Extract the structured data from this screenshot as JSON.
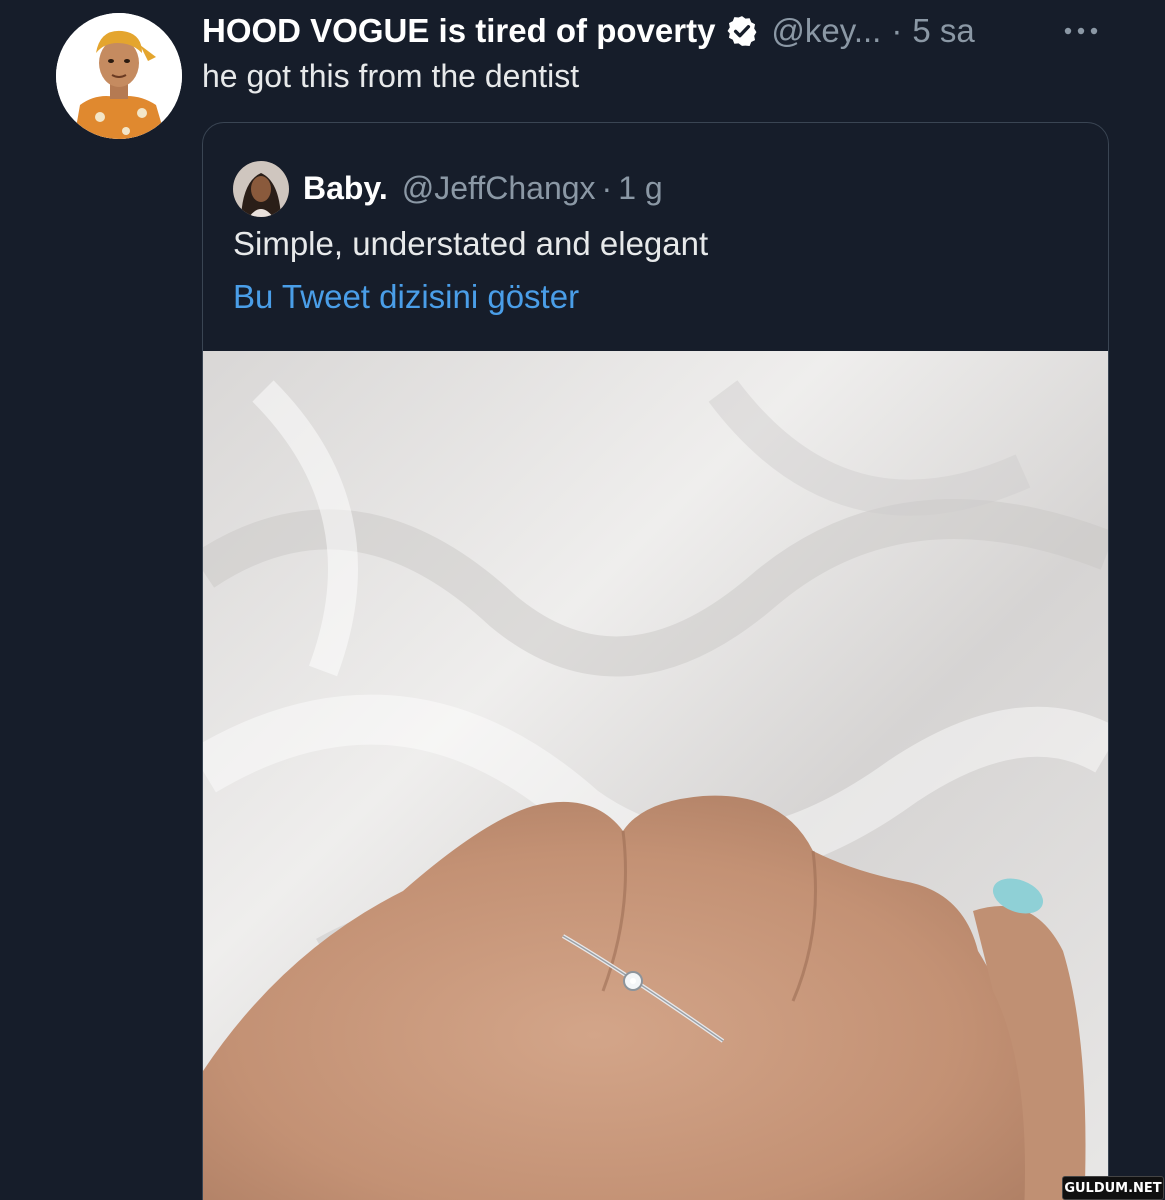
{
  "tweet": {
    "display_name": "HOOD VOGUE is tired of poverty",
    "handle": "@key...",
    "separator": "·",
    "time": "5 sa",
    "text": "he got this from the dentist",
    "verified_icon": "verified-badge-icon",
    "more_icon": "more-horizontal-icon"
  },
  "quote": {
    "display_name": "Baby.",
    "handle": "@JeffChangx",
    "separator": "·",
    "time": "1 g",
    "text": "Simple, understated and elegant",
    "show_thread": "Bu Tweet dizisini göster"
  },
  "watermark": "GULDUM.NET",
  "colors": {
    "background": "#161d2a",
    "text_primary": "#ffffff",
    "text_secondary": "#8b98a5",
    "link": "#4a9ee8",
    "border": "#3a4553"
  }
}
